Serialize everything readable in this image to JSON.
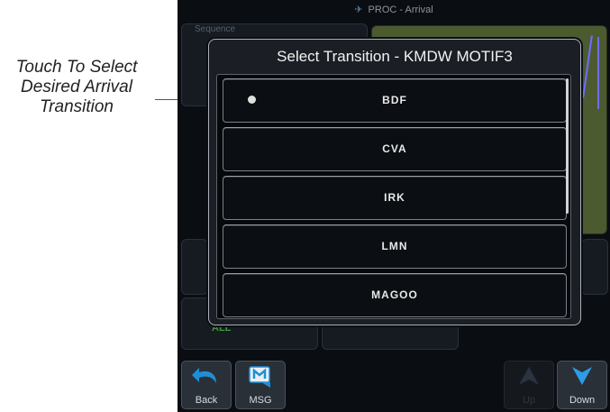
{
  "callout": {
    "text": "Touch To Select Desired Arrival Transition"
  },
  "screen": {
    "title": "PROC - Arrival",
    "background": {
      "sequence_label": "Sequence",
      "all_label": "ALL"
    },
    "dialog": {
      "title": "Select Transition - KMDW MOTIF3",
      "items": [
        {
          "label": "BDF"
        },
        {
          "label": "CVA"
        },
        {
          "label": "IRK"
        },
        {
          "label": "LMN"
        },
        {
          "label": "MAGOO"
        }
      ]
    },
    "softkeys": {
      "back": {
        "label": "Back",
        "icon": "back-arrow-icon"
      },
      "msg": {
        "label": "MSG",
        "icon": "message-icon"
      },
      "up": {
        "label": "Up",
        "icon": "up-arrow-icon",
        "enabled": false
      },
      "down": {
        "label": "Down",
        "icon": "down-arrow-icon",
        "enabled": true
      }
    }
  },
  "colors": {
    "accent": "#1e8fd6",
    "dialog_border": "#aab0b6",
    "all_label": "#3a9c3a"
  }
}
